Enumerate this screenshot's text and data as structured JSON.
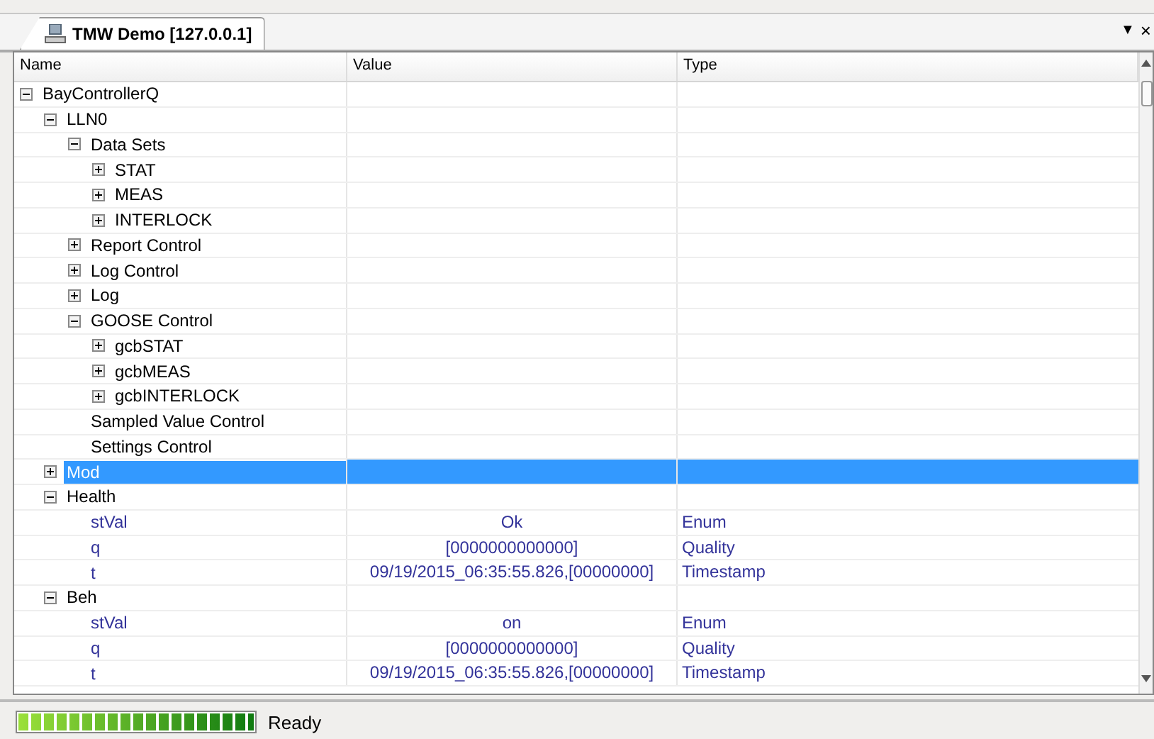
{
  "tab": {
    "title": "TMW Demo [127.0.0.1]",
    "menu_glyph": "▼",
    "close_glyph": "×"
  },
  "columns": [
    "Name",
    "Value",
    "Type"
  ],
  "tree": [
    {
      "name": "BayControllerQ",
      "kind": "node",
      "expanded": true,
      "selected": false,
      "children": [
        {
          "name": "LLN0",
          "kind": "node",
          "expanded": true,
          "selected": false,
          "children": [
            {
              "name": "Data Sets",
              "kind": "node",
              "expanded": true,
              "selected": false,
              "children": [
                {
                  "name": "STAT",
                  "kind": "node",
                  "expanded": false,
                  "selected": false
                },
                {
                  "name": "MEAS",
                  "kind": "node",
                  "expanded": false,
                  "selected": false
                },
                {
                  "name": "INTERLOCK",
                  "kind": "node",
                  "expanded": false,
                  "selected": false
                }
              ]
            },
            {
              "name": "Report Control",
              "kind": "node",
              "expanded": false,
              "selected": false
            },
            {
              "name": "Log Control",
              "kind": "node",
              "expanded": false,
              "selected": false
            },
            {
              "name": "Log",
              "kind": "node",
              "expanded": false,
              "selected": false
            },
            {
              "name": "GOOSE Control",
              "kind": "node",
              "expanded": true,
              "selected": false,
              "children": [
                {
                  "name": "gcbSTAT",
                  "kind": "node",
                  "expanded": false,
                  "selected": false
                },
                {
                  "name": "gcbMEAS",
                  "kind": "node",
                  "expanded": false,
                  "selected": false
                },
                {
                  "name": "gcbINTERLOCK",
                  "kind": "node",
                  "expanded": false,
                  "selected": false
                }
              ]
            },
            {
              "name": "Sampled Value Control",
              "kind": "leaf",
              "selected": false
            },
            {
              "name": "Settings Control",
              "kind": "leaf",
              "selected": false
            }
          ]
        },
        {
          "name": "Mod",
          "kind": "node",
          "expanded": false,
          "selected": true
        },
        {
          "name": "Health",
          "kind": "node",
          "expanded": true,
          "selected": false,
          "children": [
            {
              "name": "stVal",
              "kind": "attribute",
              "value": "Ok",
              "type": "Enum",
              "selected": false
            },
            {
              "name": "q",
              "kind": "attribute",
              "value": "[0000000000000]",
              "type": "Quality",
              "selected": false
            },
            {
              "name": "t",
              "kind": "attribute",
              "value": "09/19/2015_06:35:55.826,[00000000]",
              "type": "Timestamp",
              "selected": false
            }
          ]
        },
        {
          "name": "Beh",
          "kind": "node",
          "expanded": true,
          "selected": false,
          "children": [
            {
              "name": "stVal",
              "kind": "attribute",
              "value": "on",
              "type": "Enum",
              "selected": false
            },
            {
              "name": "q",
              "kind": "attribute",
              "value": "[0000000000000]",
              "type": "Quality",
              "selected": false
            },
            {
              "name": "t",
              "kind": "attribute",
              "value": "09/19/2015_06:35:55.826,[00000000]",
              "type": "Timestamp",
              "selected": false
            }
          ]
        }
      ]
    }
  ],
  "status_bar": {
    "progress": {
      "level": 1
    },
    "text": "Ready"
  }
}
